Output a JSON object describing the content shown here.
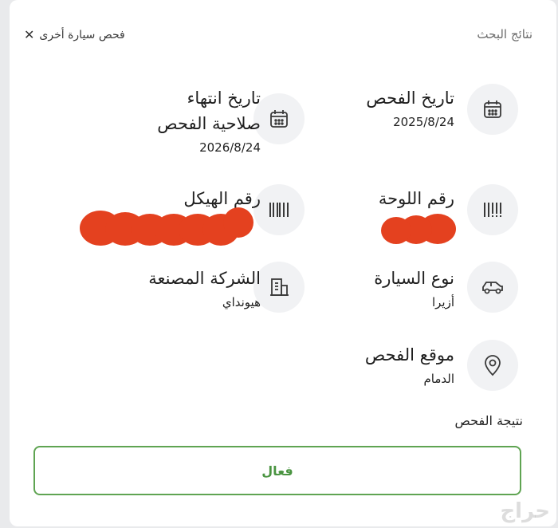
{
  "header": {
    "title": "نتائج البحث",
    "new_check_label": "فحص سيارة أخرى",
    "close_icon": "close-icon"
  },
  "fields": {
    "inspection_date": {
      "label": "تاريخ الفحص",
      "value": "2025/8/24",
      "icon": "calendar-icon"
    },
    "expiry_date": {
      "label_line1": "تاريخ انتهاء",
      "label_line2": "صلاحية الفحص",
      "value": "2026/8/24",
      "icon": "calendar-icon"
    },
    "plate_number": {
      "label": "رقم اللوحة",
      "icon": "plate-barcode-icon"
    },
    "chassis_number": {
      "label": "رقم الهيكل",
      "icon": "chassis-barcode-icon"
    },
    "vehicle_type": {
      "label": "نوع السيارة",
      "value": "أزيرا",
      "icon": "car-icon"
    },
    "manufacturer": {
      "label": "الشركة المصنعة",
      "value": "هيونداي",
      "icon": "building-icon"
    },
    "inspection_location": {
      "label": "موقع الفحص",
      "value": "الدمام",
      "icon": "location-pin-icon"
    }
  },
  "result": {
    "label": "نتيجة الفحص",
    "value": "فعال",
    "status_color": "#4a9441"
  },
  "colors": {
    "redaction": "#e4411f",
    "icon_bg": "#f1f2f4",
    "success": "#5fa452"
  },
  "watermark": "حراج"
}
